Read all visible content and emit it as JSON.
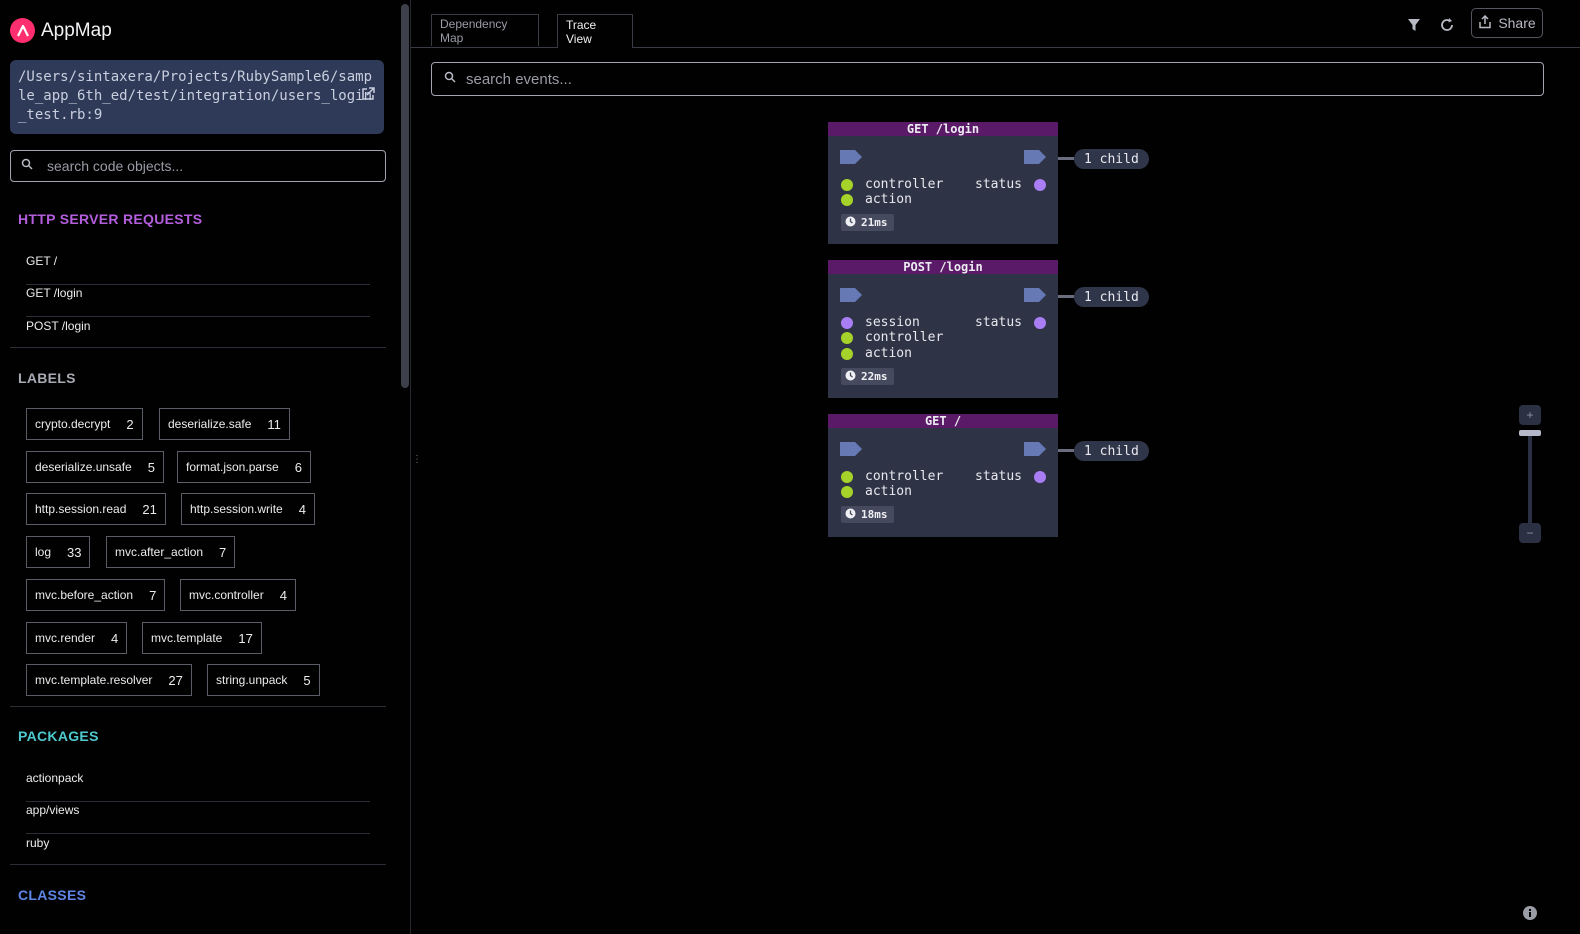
{
  "app": {
    "name": "AppMap"
  },
  "sidebar": {
    "file_path": "/Users/sintaxera/Projects/RubySample6/sample_app_6th_ed/test/integration/users_login_test.rb:9",
    "search_placeholder": "search code objects...",
    "http_title": "HTTP SERVER REQUESTS",
    "http_requests": [
      "GET /",
      "GET /login",
      "POST /login"
    ],
    "labels_title": "LABELS",
    "labels": [
      {
        "name": "crypto.decrypt",
        "count": "2"
      },
      {
        "name": "deserialize.safe",
        "count": "11"
      },
      {
        "name": "deserialize.unsafe",
        "count": "5"
      },
      {
        "name": "format.json.parse",
        "count": "6"
      },
      {
        "name": "http.session.read",
        "count": "21"
      },
      {
        "name": "http.session.write",
        "count": "4"
      },
      {
        "name": "log",
        "count": "33"
      },
      {
        "name": "mvc.after_action",
        "count": "7"
      },
      {
        "name": "mvc.before_action",
        "count": "7"
      },
      {
        "name": "mvc.controller",
        "count": "4"
      },
      {
        "name": "mvc.render",
        "count": "4"
      },
      {
        "name": "mvc.template",
        "count": "17"
      },
      {
        "name": "mvc.template.resolver",
        "count": "27"
      },
      {
        "name": "string.unpack",
        "count": "5"
      }
    ],
    "packages_title": "PACKAGES",
    "packages": [
      "actionpack",
      "app/views",
      "ruby"
    ],
    "classes_title": "CLASSES"
  },
  "tabs": [
    {
      "label": "Dependency Map",
      "active": false
    },
    {
      "label": "Trace View",
      "active": true
    }
  ],
  "toolbar": {
    "share_label": "Share"
  },
  "trace": {
    "search_placeholder": "search events...",
    "nodes": [
      {
        "title": "GET /login",
        "inputs": [
          {
            "name": "controller",
            "color": "#a6d32a"
          },
          {
            "name": "action",
            "color": "#a6d32a"
          }
        ],
        "output": "status",
        "output_color": "#a97ef4",
        "time": "21ms",
        "children": "1 child"
      },
      {
        "title": "POST /login",
        "inputs": [
          {
            "name": "session",
            "color": "#a97ef4"
          },
          {
            "name": "controller",
            "color": "#a6d32a"
          },
          {
            "name": "action",
            "color": "#a6d32a"
          }
        ],
        "output": "status",
        "output_color": "#a97ef4",
        "time": "22ms",
        "children": "1 child"
      },
      {
        "title": "GET /",
        "inputs": [
          {
            "name": "controller",
            "color": "#a6d32a"
          },
          {
            "name": "action",
            "color": "#a6d32a"
          }
        ],
        "output": "status",
        "output_color": "#a97ef4",
        "time": "18ms",
        "children": "1 child"
      }
    ]
  },
  "colors": {
    "http_title": "#b45ede",
    "labels_title": "#a8aab4",
    "packages_title": "#4ec9cf",
    "classes_title": "#5f86e6",
    "node_header": "#5b1a67",
    "node_body": "#2e3346",
    "port": "#6779b4"
  }
}
